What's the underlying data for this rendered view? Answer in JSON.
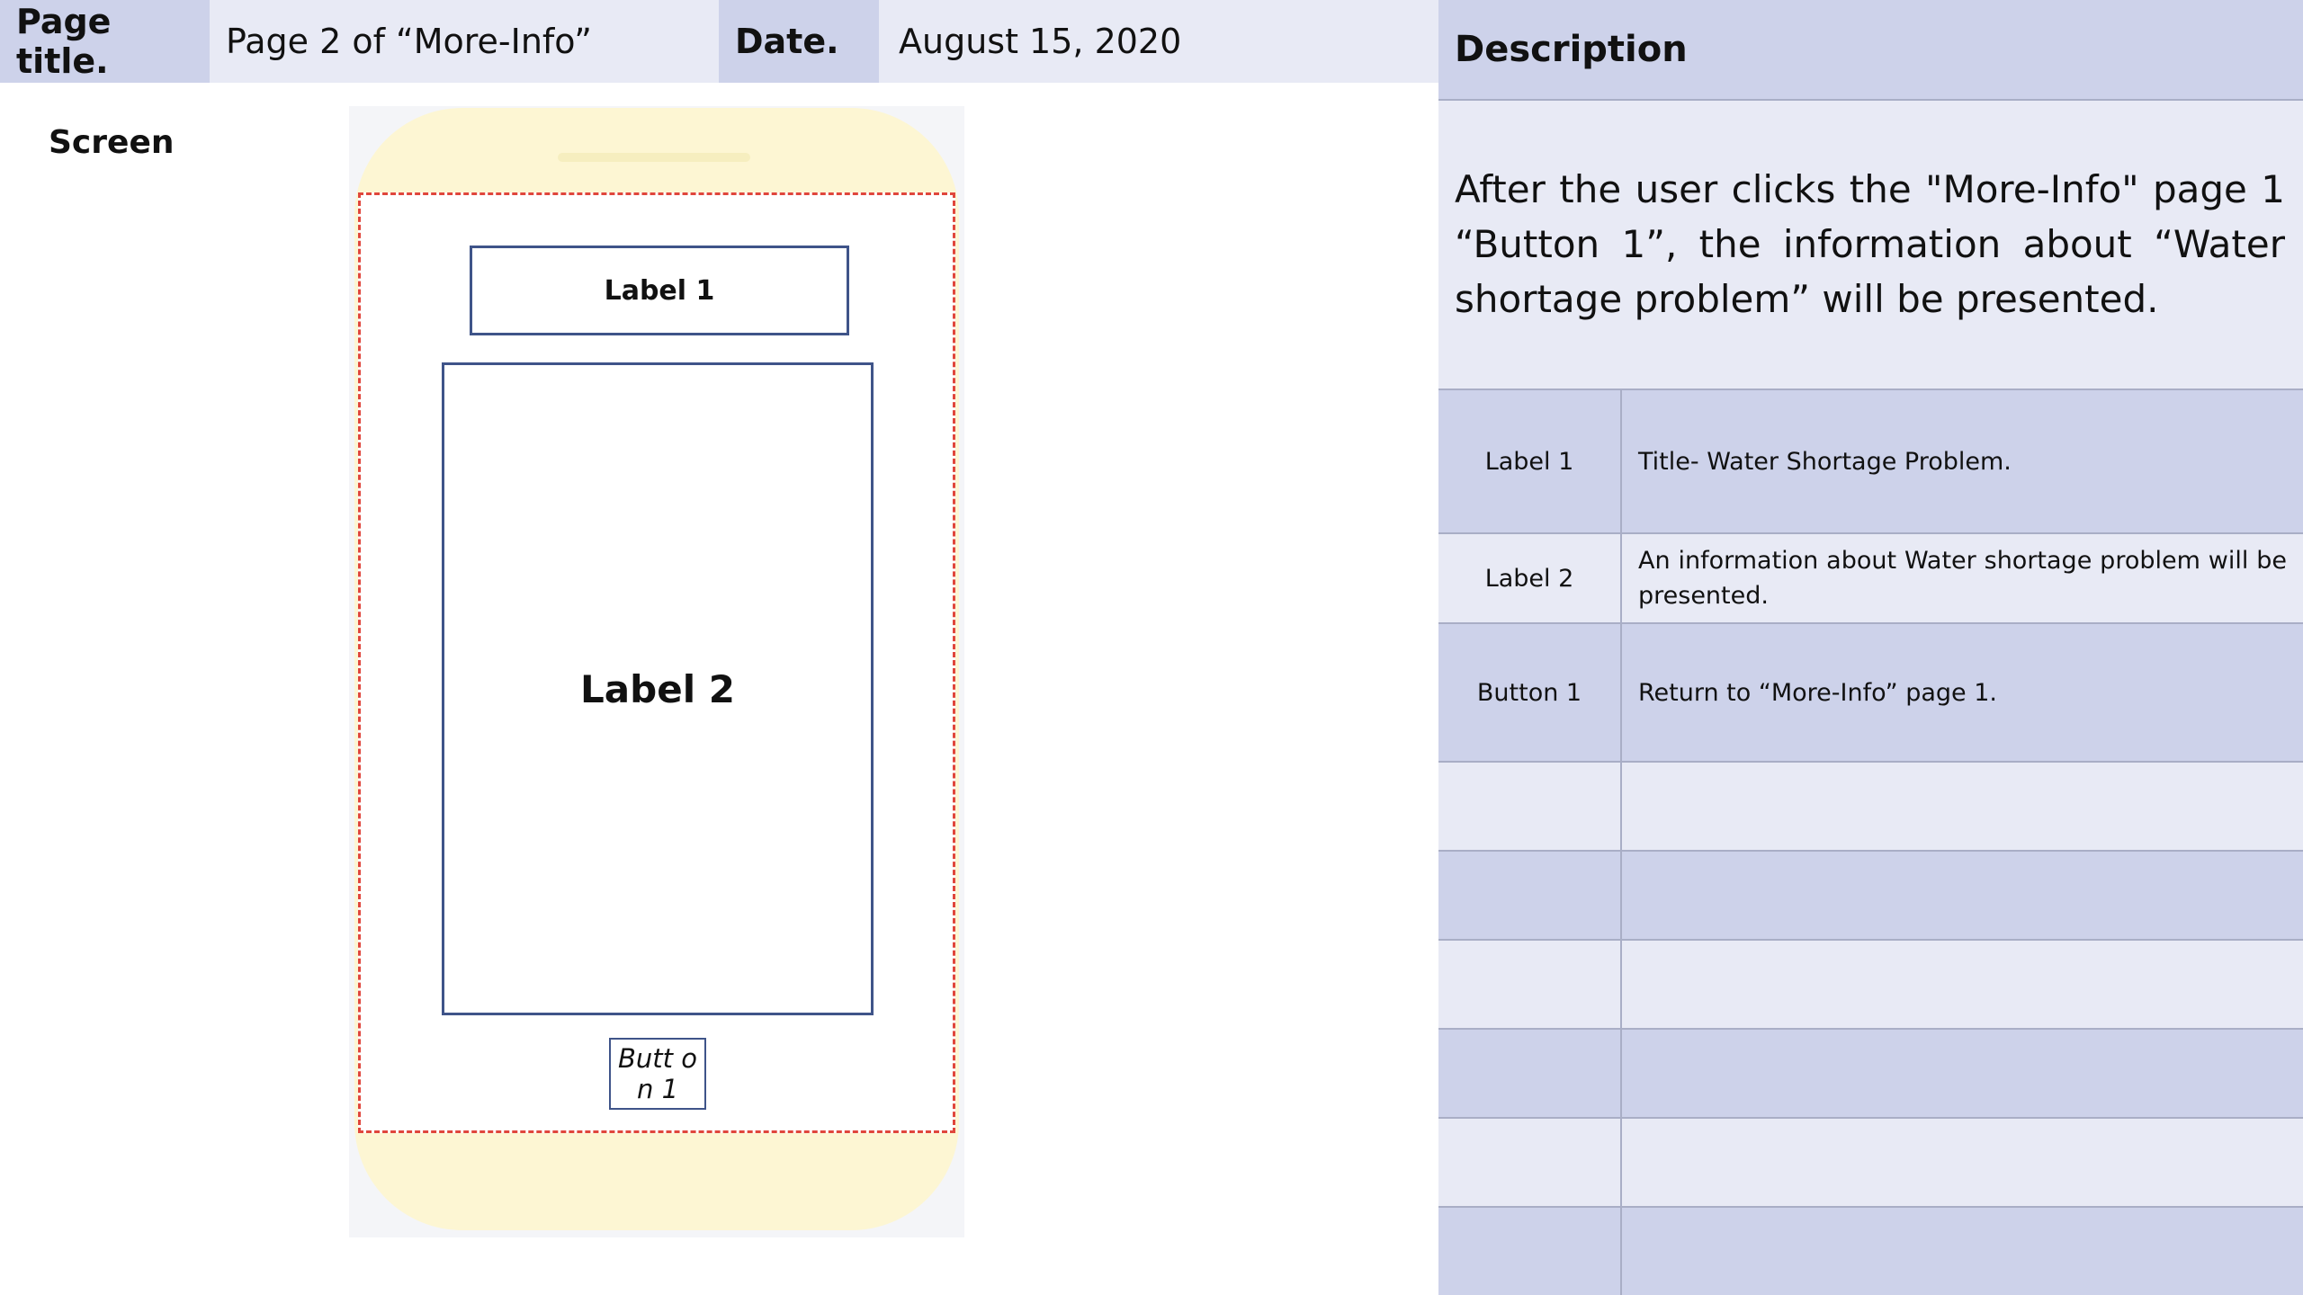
{
  "header": {
    "page_title_label": "Page title.",
    "page_title_value": "Page 2 of “More-Info”",
    "date_label": "Date.",
    "date_value": "August 15, 2020"
  },
  "screen": {
    "label": "Screen",
    "wireframe": {
      "label1": "Label 1",
      "label2": "Label 2",
      "button1": "Butt on 1"
    }
  },
  "description": {
    "heading": "Description",
    "text": "After the user clicks the \"More-Info\" page 1 “Button 1”, the information about “Water shortage problem” will be presented."
  },
  "components": [
    {
      "name": "Label 1",
      "description": "Title- Water Shortage Problem."
    },
    {
      "name": "Label 2",
      "description": "An information about Water shortage problem will be presented."
    },
    {
      "name": "Button 1",
      "description": "Return to “More-Info” page 1."
    },
    {
      "name": "",
      "description": ""
    },
    {
      "name": "",
      "description": ""
    },
    {
      "name": "",
      "description": ""
    },
    {
      "name": "",
      "description": ""
    },
    {
      "name": "",
      "description": ""
    },
    {
      "name": "",
      "description": ""
    }
  ],
  "colors": {
    "header_dark": "#cdd2ea",
    "header_light": "#e8eaf5",
    "phone_body": "#fdf6d3",
    "wireframe_border": "#3f5489",
    "screen_dashed_border": "#e0463c"
  }
}
